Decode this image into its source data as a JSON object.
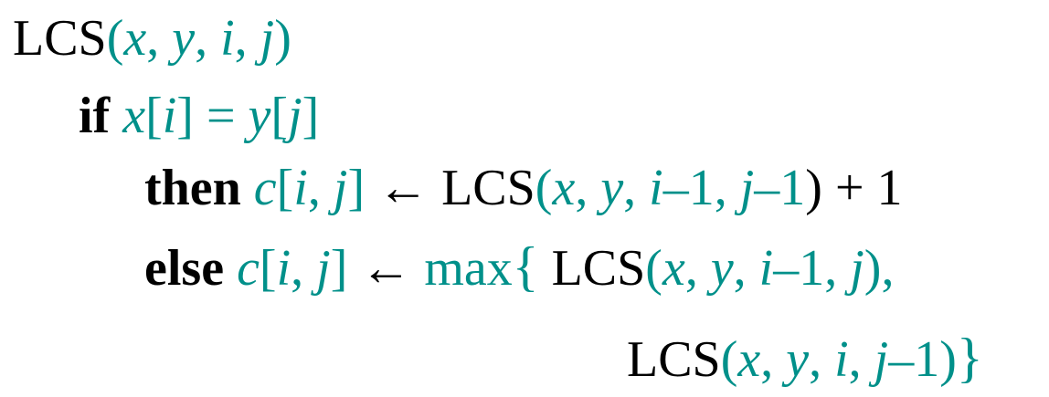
{
  "colors": {
    "black": "#000000",
    "teal": "#00908a"
  },
  "line1": {
    "lcs": "LCS",
    "open": "(",
    "x": "x",
    "c1": ", ",
    "y": "y",
    "c2": ", ",
    "i": "i",
    "c3": ", ",
    "j": "j",
    "close": ")"
  },
  "line2": {
    "kw": "if",
    "x": "x",
    "lb1": "[",
    "i": "i",
    "rb1": "]",
    "eq": " = ",
    "y": "y",
    "lb2": "[",
    "j": "j",
    "rb2": "]"
  },
  "line3": {
    "kw": "then",
    "c": "c",
    "lb": "[",
    "i": "i",
    "comma": ", ",
    "j": "j",
    "rb": "]",
    "arrow": " ← ",
    "lcs": "LCS",
    "open": "(",
    "x": "x",
    "c1": ", ",
    "y": "y",
    "c2": ", ",
    "i2": "i",
    "m1": "–1",
    "c3": ", ",
    "j2": "j",
    "m2": "–1",
    "close": ")",
    "plus": " + 1"
  },
  "line4": {
    "kw": "else",
    "c": "c",
    "lb": "[",
    "i": "i",
    "comma": ", ",
    "j": "j",
    "rb": "]",
    "arrow": " ← ",
    "max": "max",
    "brace": "{",
    "lcs": "LCS",
    "open": "(",
    "x": "x",
    "c1": ", ",
    "y": "y",
    "c2": ", ",
    "i2": "i",
    "m1": "–1",
    "c3": ", ",
    "j2": "j",
    "close": ")",
    "tail": ","
  },
  "line5": {
    "lcs": "LCS",
    "open": "(",
    "x": "x",
    "c1": ", ",
    "y": "y",
    "c2": ", ",
    "i": "i",
    "c3": ", ",
    "j": "j",
    "m": "–1",
    "close": ")",
    "brace": "}"
  }
}
